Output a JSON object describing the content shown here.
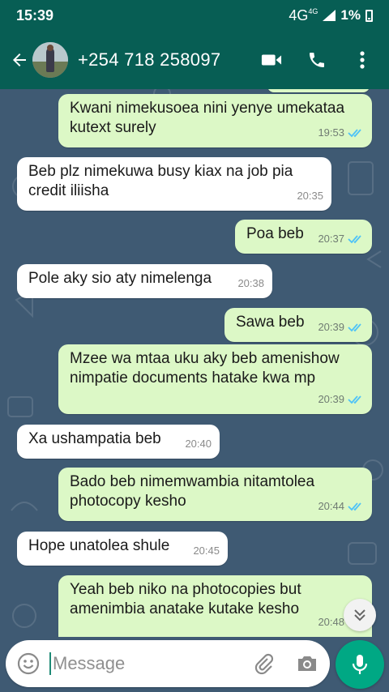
{
  "status_bar": {
    "time": "15:39",
    "network": "4G",
    "network_sup": "4G",
    "battery": "1%"
  },
  "header": {
    "contact": "+254 718 258097"
  },
  "messages": [
    {
      "direction": "out",
      "text": "Kwani nimekusoea nini yenye umekataa kutext surely",
      "time": "19:53",
      "status": "read"
    },
    {
      "direction": "in",
      "text": "Beb plz nimekuwa busy kiax na job pia credit iliisha",
      "time": "20:35"
    },
    {
      "direction": "out",
      "text": "Poa beb",
      "time": "20:37",
      "status": "read"
    },
    {
      "direction": "in",
      "text": "Pole aky sio aty nimelenga",
      "time": "20:38"
    },
    {
      "direction": "out",
      "text": "Sawa beb",
      "time": "20:39",
      "status": "read"
    },
    {
      "direction": "out",
      "text": "Mzee wa mtaa uku aky beb amenishow nimpatie documents hatake kwa mp",
      "time": "20:39",
      "status": "read"
    },
    {
      "direction": "in",
      "text": "Xa ushampatia beb",
      "time": "20:40"
    },
    {
      "direction": "out",
      "text": "Bado beb nimemwambia nitamtolea photocopy kesho",
      "time": "20:44",
      "status": "read"
    },
    {
      "direction": "in",
      "text": "Hope unatolea shule",
      "time": "20:45"
    },
    {
      "direction": "out",
      "text": "Yeah beb niko na photocopies but amenimbia anatake  kutake kesho",
      "time": "20:48",
      "status": "read"
    }
  ],
  "composer": {
    "placeholder": "Message"
  },
  "colors": {
    "header": "#075e54",
    "outgoing": "#dcf8c6",
    "incoming": "#ffffff",
    "read_tick": "#4fc3f7",
    "mic": "#00a884",
    "wallpaper": "#3f5a73"
  }
}
